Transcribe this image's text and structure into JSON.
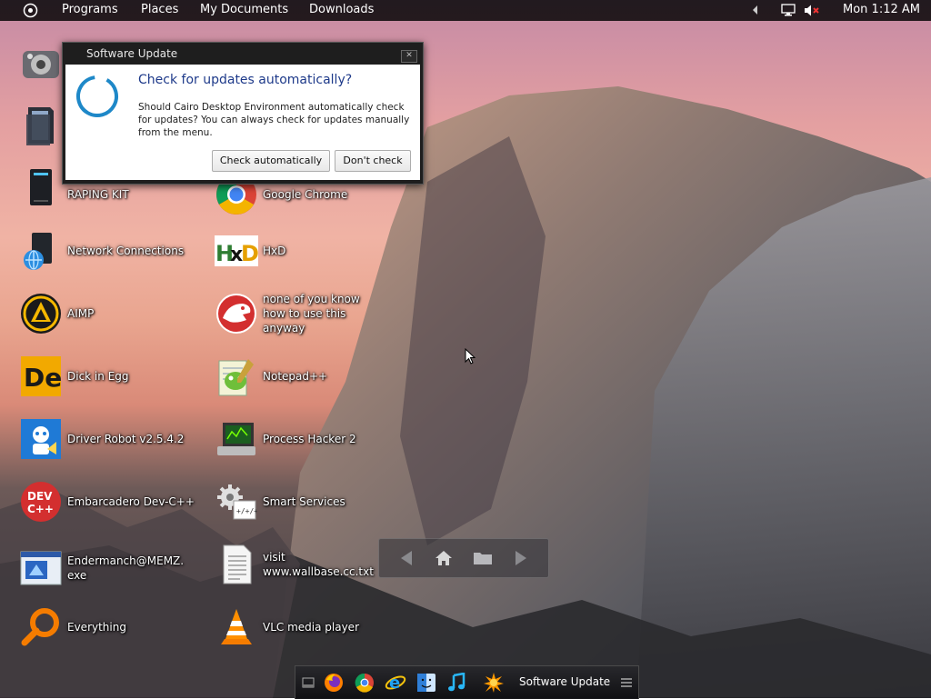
{
  "menubar": {
    "items": [
      "Programs",
      "Places",
      "My Documents",
      "Downloads"
    ],
    "clock": "Mon 1:12 AM"
  },
  "dialog": {
    "title": "Software Update",
    "heading": "Check for updates automatically?",
    "message": "Should Cairo Desktop Environment automatically check for updates? You can always check for updates manually from the menu.",
    "buttons": {
      "check": "Check automatically",
      "dont": "Don't check"
    }
  },
  "desktop": {
    "left_column": [
      {
        "label": "",
        "icon": "control-panel-icon"
      },
      {
        "label": "",
        "icon": "folder-icon"
      },
      {
        "label": "RAPING KIT",
        "icon": "computer-icon"
      },
      {
        "label": "Network Connections",
        "icon": "network-icon"
      },
      {
        "label": "AIMP",
        "icon": "aimp-icon"
      },
      {
        "label": "Dick in Egg",
        "icon": "dick-in-egg-icon"
      },
      {
        "label": "Driver Robot v2.5.4.2",
        "icon": "driver-robot-icon"
      },
      {
        "label": "Embarcadero Dev-C++",
        "icon": "devcpp-icon"
      },
      {
        "label": "Endermanch@MEMZ.exe",
        "icon": "memz-icon"
      },
      {
        "label": "Everything",
        "icon": "everything-icon"
      }
    ],
    "right_column": [
      {
        "label": "Google Chrome",
        "icon": "chrome-icon"
      },
      {
        "label": "HxD",
        "icon": "hxd-icon"
      },
      {
        "label": "none of you know how to use this anyway",
        "icon": "red-dinosaur-icon"
      },
      {
        "label": "Notepad++",
        "icon": "notepadpp-icon"
      },
      {
        "label": "Process Hacker 2",
        "icon": "process-hacker-icon"
      },
      {
        "label": "Smart Services",
        "icon": "gear-icon"
      },
      {
        "label": "visit www.wallbase.cc.txt",
        "icon": "text-file-icon"
      },
      {
        "label": "VLC media player",
        "icon": "vlc-icon"
      }
    ]
  },
  "taskbar": {
    "active_window": "Software Update",
    "pinned": [
      "desktop-icon",
      "firefox-icon",
      "chrome-icon",
      "ie-icon",
      "finder-icon",
      "music-icon"
    ]
  },
  "colors": {
    "menubar_bg": "#1a141a",
    "dialog_heading": "#1e3a8a",
    "spinner": "#1e88c8"
  }
}
